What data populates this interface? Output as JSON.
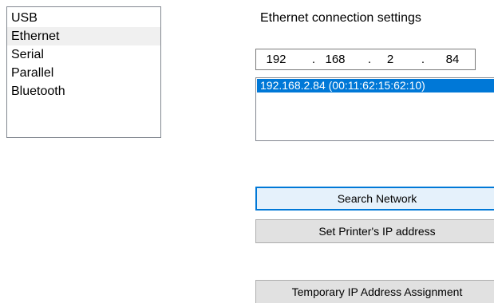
{
  "connection_types": {
    "items": [
      "USB",
      "Ethernet",
      "Serial",
      "Parallel",
      "Bluetooth"
    ],
    "selected": "Ethernet"
  },
  "ethernet": {
    "title": "Ethernet connection settings",
    "ip": {
      "octet1": "192",
      "octet2": "168",
      "octet3": "2",
      "octet4": "84",
      "dot": "."
    },
    "found_printers": [
      "192.168.2.84 (00:11:62:15:62:10)"
    ],
    "search_label": "Search Network",
    "set_ip_label": "Set Printer's IP address",
    "temp_ip_label": "Temporary IP Address Assignment"
  },
  "colors": {
    "selection_highlight": "#0078d7",
    "button_face": "#e1e1e1"
  }
}
